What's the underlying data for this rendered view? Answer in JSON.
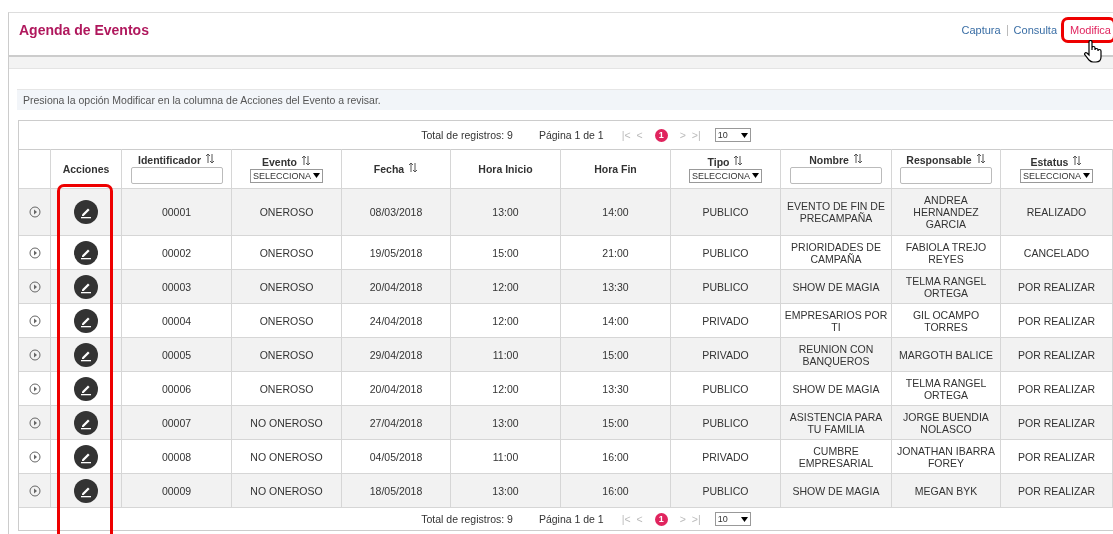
{
  "header": {
    "title": "Agenda de Eventos",
    "nav": [
      {
        "label": "Captura",
        "selected": false,
        "highlighted": false
      },
      {
        "label": "Consulta",
        "selected": false,
        "highlighted": false
      },
      {
        "label": "Modifica",
        "selected": true,
        "highlighted": true
      }
    ]
  },
  "instructions": "Presiona la opción Modificar en la columna de Acciones del Evento a revisar.",
  "pager_top": {
    "total": "Total de registros: 9",
    "page": "Página 1 de 1",
    "first": "|<",
    "prev": "<",
    "current": "1",
    "next": ">",
    "last": ">|",
    "page_size": "10"
  },
  "table": {
    "actions_header": "Acciones",
    "actions_highlighted": true,
    "columns": [
      {
        "label": "Identificador",
        "sortable": true,
        "kind": "text"
      },
      {
        "label": "Evento",
        "sortable": true,
        "kind": "select",
        "placeholder": "SELECCIONA"
      },
      {
        "label": "Fecha",
        "sortable": true,
        "kind": "plain"
      },
      {
        "label": "Hora Inicio",
        "sortable": false,
        "kind": "plain"
      },
      {
        "label": "Hora Fin",
        "sortable": false,
        "kind": "plain"
      },
      {
        "label": "Tipo",
        "sortable": true,
        "kind": "select",
        "placeholder": "SELECCIONA"
      },
      {
        "label": "Nombre",
        "sortable": true,
        "kind": "text"
      },
      {
        "label": "Responsable",
        "sortable": true,
        "kind": "text"
      },
      {
        "label": "Estatus",
        "sortable": true,
        "kind": "select",
        "placeholder": "SELECCIONA"
      }
    ],
    "rows": [
      {
        "cells": [
          "00001",
          "ONEROSO",
          "08/03/2018",
          "13:00",
          "14:00",
          "PUBLICO",
          "EVENTO DE FIN DE PRECAMPAÑA",
          "ANDREA HERNANDEZ GARCIA",
          "REALIZADO"
        ]
      },
      {
        "cells": [
          "00002",
          "ONEROSO",
          "19/05/2018",
          "15:00",
          "21:00",
          "PUBLICO",
          "PRIORIDADES DE CAMPAÑA",
          "FABIOLA TREJO REYES",
          "CANCELADO"
        ]
      },
      {
        "cells": [
          "00003",
          "ONEROSO",
          "20/04/2018",
          "12:00",
          "13:30",
          "PUBLICO",
          "SHOW DE MAGIA",
          "TELMA RANGEL ORTEGA",
          "POR REALIZAR"
        ]
      },
      {
        "cells": [
          "00004",
          "ONEROSO",
          "24/04/2018",
          "12:00",
          "14:00",
          "PRIVADO",
          "EMPRESARIOS POR TI",
          "GIL OCAMPO TORRES",
          "POR REALIZAR"
        ]
      },
      {
        "cells": [
          "00005",
          "ONEROSO",
          "29/04/2018",
          "11:00",
          "15:00",
          "PRIVADO",
          "REUNION CON BANQUEROS",
          "MARGOTH BALICE",
          "POR REALIZAR"
        ]
      },
      {
        "cells": [
          "00006",
          "ONEROSO",
          "20/04/2018",
          "12:00",
          "13:30",
          "PUBLICO",
          "SHOW DE MAGIA",
          "TELMA RANGEL ORTEGA",
          "POR REALIZAR"
        ]
      },
      {
        "cells": [
          "00007",
          "NO ONEROSO",
          "27/04/2018",
          "13:00",
          "15:00",
          "PUBLICO",
          "ASISTENCIA PARA TU FAMILIA",
          "JORGE BUENDIA NOLASCO",
          "POR REALIZAR"
        ]
      },
      {
        "cells": [
          "00008",
          "NO ONEROSO",
          "04/05/2018",
          "11:00",
          "16:00",
          "PRIVADO",
          "CUMBRE EMPRESARIAL",
          "JONATHAN IBARRA FOREY",
          "POR REALIZAR"
        ]
      },
      {
        "cells": [
          "00009",
          "NO ONEROSO",
          "18/05/2018",
          "13:00",
          "16:00",
          "PUBLICO",
          "SHOW DE MAGIA",
          "MEGAN BYK",
          "POR REALIZAR"
        ]
      }
    ]
  },
  "pager_bottom": {
    "total": "Total de registros: 9",
    "page": "Página 1 de 1",
    "first": "|<",
    "prev": "<",
    "current": "1",
    "next": ">",
    "last": ">|",
    "page_size": "10"
  }
}
